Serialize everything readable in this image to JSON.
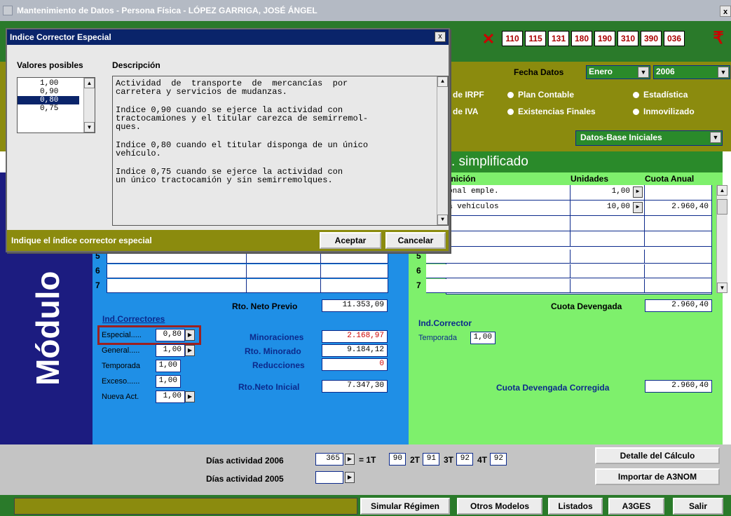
{
  "window": {
    "title": "Mantenimiento de Datos - Persona Física - LÓPEZ GARRIGA, JOSÉ ÁNGEL",
    "close": "x"
  },
  "model_buttons": [
    "110",
    "115",
    "131",
    "180",
    "190",
    "310",
    "390",
    "036"
  ],
  "fecha": {
    "label": "Fecha Datos",
    "mes": "Enero",
    "anio": "2006"
  },
  "radios": {
    "row1": [
      "de IRPF",
      "Plan Contable",
      "Estadística"
    ],
    "row2": [
      "de IVA",
      "Existencias Finales",
      "Inmovilizado"
    ]
  },
  "datos_base": "Datos-Base Iniciales",
  "simplificado_title": ". simplificado",
  "right_table": {
    "headers": {
      "def": "inición",
      "unidades": "Unidades",
      "cuota": "Cuota Anual"
    },
    "rows": [
      {
        "label": "onal emple.",
        "unidades": "1,00",
        "cuota": ""
      },
      {
        "label": "a vehículos",
        "unidades": "10,00",
        "cuota": "2.960,40"
      }
    ],
    "row_numbers": [
      "5",
      "6",
      "7"
    ]
  },
  "left_table": {
    "row_numbers": [
      "5",
      "6",
      "7"
    ]
  },
  "modulo_label": "Módulo",
  "rto": {
    "neto_previo_label": "Rto. Neto Previo",
    "neto_previo": "11.353,09",
    "minoraciones_label": "Minoraciones",
    "minoraciones": "2.168,97",
    "minorado_label": "Rto. Minorado",
    "minorado": "9.184,12",
    "reducciones_label": "Reducciones",
    "reducciones": "0",
    "neto_inicial_label": "Rto.Neto Inicial",
    "neto_inicial": "7.347,30"
  },
  "ind_correctores": {
    "title": "Ind.Correctores",
    "items": [
      {
        "label": "Especial.....",
        "value": "0,80"
      },
      {
        "label": "General.....",
        "value": "1,00"
      },
      {
        "label": "Temporada",
        "value": "1,00"
      },
      {
        "label": "Exceso......",
        "value": "1,00"
      },
      {
        "label": "Nueva Act.",
        "value": "1,00"
      }
    ]
  },
  "right_corrector": {
    "cuota_devengada_label": "Cuota Devengada",
    "cuota_devengada": "2.960,40",
    "title": "Ind.Corrector",
    "temporada_label": "Temporada",
    "temporada": "1,00",
    "corregida_label": "Cuota Devengada Corregida",
    "corregida": "2.960,40"
  },
  "dias": {
    "label_2006": "Días actividad 2006",
    "valor_2006": "365",
    "eq": "= 1T",
    "t1": "90",
    "t2_label": "2T",
    "t2": "91",
    "t3_label": "3T",
    "t3": "92",
    "t4_label": "4T",
    "t4": "92",
    "label_2005": "Días actividad 2005",
    "valor_2005": ""
  },
  "actions": {
    "detalle": "Detalle del Cálculo",
    "importar": "Importar de A3NOM"
  },
  "bottom_buttons": [
    "Simular Régimen",
    "Otros Modelos",
    "Listados",
    "A3GES",
    "Salir"
  ],
  "dialog": {
    "title": "Indice Corrector Especial",
    "close": "x",
    "col_valores": "Valores posibles",
    "col_descripcion": "Descripción",
    "options": [
      "1,00",
      "0,90",
      "0,80",
      "0,75"
    ],
    "selected_index": 2,
    "description": [
      "Actividad  de  transporte  de  mercancías  por\ncarretera y servicios de mudanzas.",
      "Indice 0,90 cuando se ejerce la actividad con\ntractocamiones y el titular carezca de semirremol-\nques.",
      "Indice 0,80 cuando el titular disponga de un único\nvehículo.",
      "Indice 0,75 cuando se ejerce la actividad con\nun único tractocamión y sin semirremolques."
    ],
    "prompt": "Indique el índice corrector especial",
    "aceptar": "Aceptar",
    "cancelar": "Cancelar"
  },
  "colors": {
    "green": "#2a7a2a",
    "olive": "#8b8b0e",
    "navy": "#0a246a",
    "blue": "#1f8fe6",
    "lightgreen": "#7ef06c",
    "red": "#cc0000"
  }
}
